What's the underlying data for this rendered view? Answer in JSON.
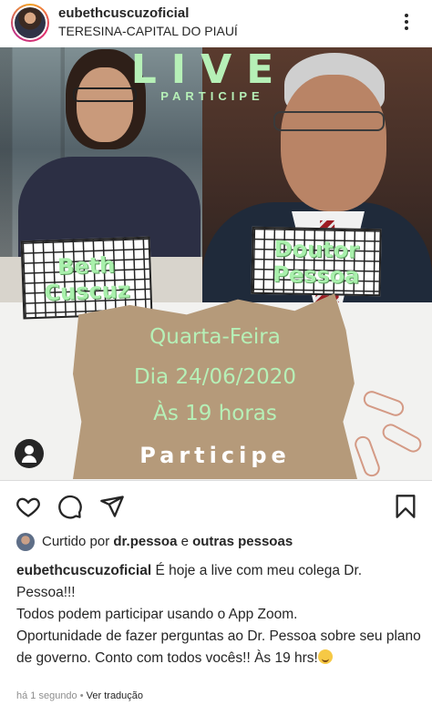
{
  "header": {
    "username": "eubethcuscuzoficial",
    "location": "TERESINA-CAPITAL DO PIAUÍ"
  },
  "post_image": {
    "live_title": "LIVE",
    "live_subtitle": "PARTICIPE",
    "name_left_line1": "Beth",
    "name_left_line2": "Cuscuz",
    "name_right_line1": "Doutor",
    "name_right_line2": "Pessoa",
    "day": "Quarta-Feira",
    "date": "Dia 24/06/2020",
    "time": "Às 19 horas",
    "call_to_action": "Participe"
  },
  "likes": {
    "prefix": "Curtido por",
    "user": "dr.pessoa",
    "connector": "e",
    "others": "outras pessoas"
  },
  "caption": {
    "user": "eubethcuscuzoficial",
    "line1": "É hoje a live com meu colega Dr. Pessoa!!!",
    "line2": "Todos podem participar usando o App Zoom.",
    "line3": "Oportunidade de fazer perguntas ao Dr. Pessoa sobre seu plano de governo. Conto com todos vocês!! Às 19 hrs!"
  },
  "meta": {
    "timestamp": "há 1 segundo",
    "separator": "•",
    "translate": "Ver tradução"
  },
  "icons": {
    "like": "heart-icon",
    "comment": "comment-icon",
    "share": "send-icon",
    "save": "bookmark-icon",
    "more": "more-vertical-icon",
    "tag": "user-tag-icon"
  },
  "colors": {
    "accent_green": "#b6f0b7",
    "text": "#262626",
    "muted": "#8e8e8e",
    "cardboard": "#b59a7a"
  }
}
